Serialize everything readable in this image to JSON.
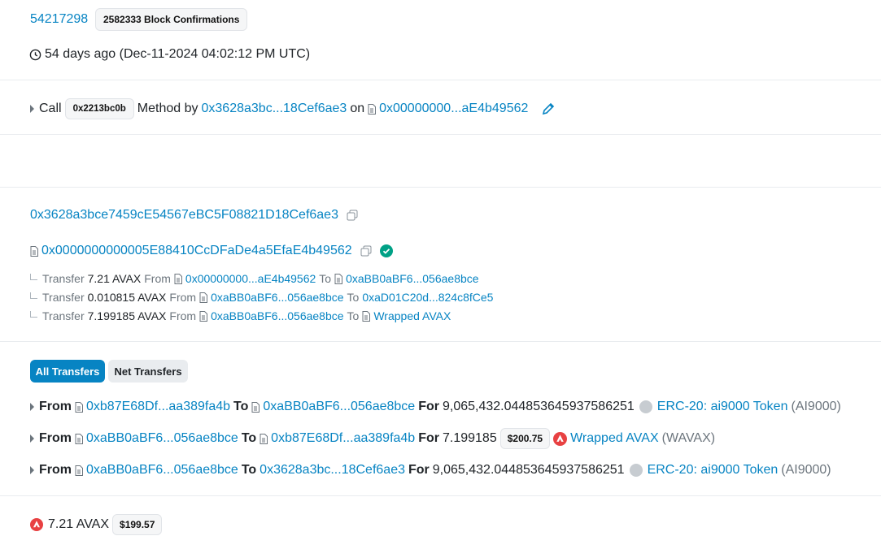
{
  "block": {
    "number": "54217298",
    "confirmations": "2582333 Block Confirmations",
    "timestamp": "54 days ago (Dec-11-2024 04:02:12 PM UTC)"
  },
  "action": {
    "call_label": "Call",
    "method_id": "0x2213bc0b",
    "method_by_label": "Method by",
    "from": "0x3628a3bc...18Cef6ae3",
    "on_label": "on",
    "to": "0x00000000...aE4b49562"
  },
  "from_address": "0x3628a3bce7459cE54567eBC5F08821D18Cef6ae3",
  "interacted_with": {
    "address": "0x0000000000005E88410CcDFaDe4a5EfaE4b49562",
    "transfers": [
      {
        "label": "Transfer",
        "amount": "7.21 AVAX",
        "from_label": "From",
        "from": "0x00000000...aE4b49562",
        "to_label": "To",
        "to": "0xaBB0aBF6...056ae8bce"
      },
      {
        "label": "Transfer",
        "amount": "0.010815 AVAX",
        "from_label": "From",
        "from": "0xaBB0aBF6...056ae8bce",
        "to_label": "To",
        "to": "0xaD01C20d...824c8fCe5"
      },
      {
        "label": "Transfer",
        "amount": "7.199185 AVAX",
        "from_label": "From",
        "from": "0xaBB0aBF6...056ae8bce",
        "to_label": "To",
        "to": "Wrapped AVAX"
      }
    ]
  },
  "tabs": {
    "all": "All Transfers",
    "net": "Net Transfers"
  },
  "token_transfers": [
    {
      "from_label": "From",
      "from": "0xb87E68Df...aa389fa4b",
      "to_label": "To",
      "to": "0xaBB0aBF6...056ae8bce",
      "for_label": "For",
      "amount": "9,065,432.044853645937586251",
      "usd": "",
      "token_link": "ERC-20: ai9000 Token",
      "token_symbol": "(AI9000)"
    },
    {
      "from_label": "From",
      "from": "0xaBB0aBF6...056ae8bce",
      "to_label": "To",
      "to": "0xb87E68Df...aa389fa4b",
      "for_label": "For",
      "amount": "7.199185",
      "usd": "$200.75",
      "token_link": "Wrapped AVAX",
      "token_symbol": "(WAVAX)"
    },
    {
      "from_label": "From",
      "from": "0xaBB0aBF6...056ae8bce",
      "to_label": "To",
      "to": "0x3628a3bc...18Cef6ae3",
      "for_label": "For",
      "amount": "9,065,432.044853645937586251",
      "usd": "",
      "token_link": "ERC-20: ai9000 Token",
      "token_symbol": "(AI9000)"
    }
  ],
  "value": {
    "amount": "7.21 AVAX",
    "usd": "$199.57"
  },
  "colors": {
    "link": "#0784c3",
    "success": "#00a186",
    "avax_red": "#e84142",
    "tab_active": "#0784c3"
  }
}
